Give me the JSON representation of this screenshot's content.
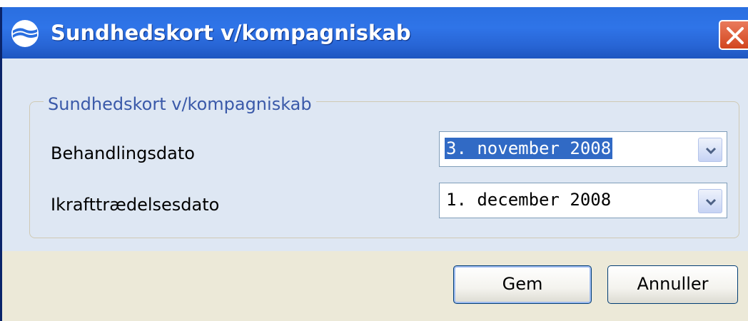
{
  "window": {
    "title": "Sundhedskort v/kompagniskab"
  },
  "group": {
    "legend": "Sundhedskort v/kompagniskab",
    "fields": [
      {
        "label": "Behandlingsdato",
        "value": "3. november 2008"
      },
      {
        "label": "Ikrafttrædelsesdato",
        "value": "1. december 2008"
      }
    ]
  },
  "buttons": {
    "save": "Gem",
    "cancel": "Annuller"
  },
  "colors": {
    "titlebar": "#2a6fe0",
    "close": "#d2461e",
    "selection": "#316ac5"
  }
}
